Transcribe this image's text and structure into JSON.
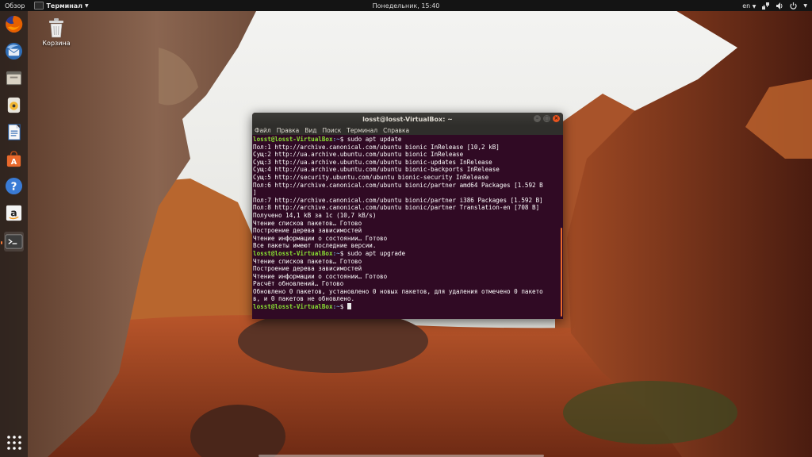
{
  "topbar": {
    "activities": "Обзор",
    "app_name": "Терминал",
    "clock": "Понедельник, 15:40",
    "keyboard_layout": "en"
  },
  "desktop": {
    "trash_label": "Корзина"
  },
  "dock": {
    "items": [
      {
        "icon": "firefox-icon"
      },
      {
        "icon": "thunderbird-icon"
      },
      {
        "icon": "files-icon"
      },
      {
        "icon": "rhythmbox-icon"
      },
      {
        "icon": "libreoffice-writer-icon"
      },
      {
        "icon": "software-center-icon"
      },
      {
        "icon": "help-icon"
      },
      {
        "icon": "amazon-icon"
      },
      {
        "icon": "terminal-icon"
      }
    ],
    "show_apps_icon": "grid-icon"
  },
  "terminal": {
    "title": "losst@losst-VirtualBox: ~",
    "menu": [
      "Файл",
      "Правка",
      "Вид",
      "Поиск",
      "Терминал",
      "Справка"
    ],
    "prompt_user": "losst@losst-VirtualBox",
    "prompt_path": ":~",
    "lines": [
      {
        "type": "prompt",
        "cmd": "$ sudo apt update"
      },
      {
        "type": "out",
        "text": "Пол:1 http://archive.canonical.com/ubuntu bionic InRelease [10,2 kB]"
      },
      {
        "type": "out",
        "text": "Сущ:2 http://ua.archive.ubuntu.com/ubuntu bionic InRelease"
      },
      {
        "type": "out",
        "text": "Сущ:3 http://ua.archive.ubuntu.com/ubuntu bionic-updates InRelease"
      },
      {
        "type": "out",
        "text": "Сущ:4 http://ua.archive.ubuntu.com/ubuntu bionic-backports InRelease"
      },
      {
        "type": "out",
        "text": "Сущ:5 http://security.ubuntu.com/ubuntu bionic-security InRelease"
      },
      {
        "type": "out",
        "text": "Пол:6 http://archive.canonical.com/ubuntu bionic/partner amd64 Packages [1.592 B"
      },
      {
        "type": "out",
        "text": "]"
      },
      {
        "type": "out",
        "text": "Пол:7 http://archive.canonical.com/ubuntu bionic/partner i386 Packages [1.592 B]"
      },
      {
        "type": "out",
        "text": "Пол:8 http://archive.canonical.com/ubuntu bionic/partner Translation-en [708 B]"
      },
      {
        "type": "out",
        "text": "Получено 14,1 kB за 1с (10,7 kB/s)"
      },
      {
        "type": "out",
        "text": "Чтение списков пакетов… Готово"
      },
      {
        "type": "out",
        "text": "Построение дерева зависимостей"
      },
      {
        "type": "out",
        "text": "Чтение информации о состоянии… Готово"
      },
      {
        "type": "out",
        "text": "Все пакеты имеют последние версии."
      },
      {
        "type": "prompt",
        "cmd": "$ sudo apt upgrade"
      },
      {
        "type": "out",
        "text": "Чтение списков пакетов… Готово"
      },
      {
        "type": "out",
        "text": "Построение дерева зависимостей"
      },
      {
        "type": "out",
        "text": "Чтение информации о состоянии… Готово"
      },
      {
        "type": "out",
        "text": "Расчёт обновлений… Готово"
      },
      {
        "type": "out",
        "text": "Обновлено 0 пакетов, установлено 0 новых пакетов, для удаления отмечено 0 пакето"
      },
      {
        "type": "out",
        "text": "в, и 0 пакетов не обновлено."
      },
      {
        "type": "prompt",
        "cmd": "$ "
      }
    ]
  },
  "colors": {
    "terminal_bg": "#300a24",
    "prompt_user": "#8ae234",
    "prompt_path": "#729fcf",
    "accent": "#e9541f"
  }
}
